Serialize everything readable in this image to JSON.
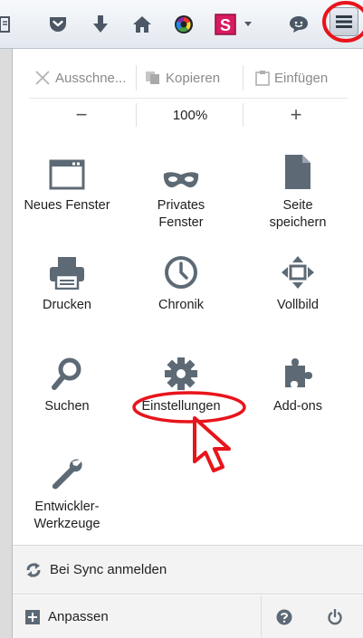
{
  "toolbar": {
    "icons": [
      "bookmarks-icon",
      "pocket-icon",
      "downloads-icon",
      "home-icon",
      "colorful-addon-icon",
      "s-addon-icon",
      "dropdown-arrow-icon",
      "chat-icon",
      "menu-icon"
    ]
  },
  "edit": {
    "cut_label": "Ausschne...",
    "copy_label": "Kopieren",
    "paste_label": "Einfügen"
  },
  "zoom": {
    "out_label": "−",
    "level_label": "100%",
    "in_label": "+"
  },
  "items": [
    {
      "label": "Neues Fenster",
      "icon": "new-window-icon"
    },
    {
      "label": "Privates\nFenster",
      "icon": "private-mask-icon"
    },
    {
      "label": "Seite\nspeichern",
      "icon": "save-page-icon"
    },
    {
      "label": "Drucken",
      "icon": "printer-icon"
    },
    {
      "label": "Chronik",
      "icon": "clock-icon"
    },
    {
      "label": "Vollbild",
      "icon": "fullscreen-icon"
    },
    {
      "label": "Suchen",
      "icon": "magnifier-icon"
    },
    {
      "label": "Einstellungen",
      "icon": "gear-icon"
    },
    {
      "label": "Add-ons",
      "icon": "puzzle-icon"
    },
    {
      "label": "Entwickler-\nWerkzeuge",
      "icon": "wrench-icon"
    }
  ],
  "footer": {
    "sync_label": "Bei Sync anmelden",
    "customize_label": "Anpassen",
    "help_icon": "help-icon",
    "quit_icon": "power-icon"
  },
  "colors": {
    "highlight": "#e8141b",
    "icon_gray": "#5d6a76"
  }
}
